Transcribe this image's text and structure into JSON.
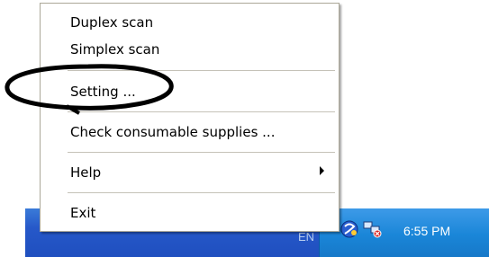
{
  "menu": {
    "items": [
      {
        "label": "Duplex scan"
      },
      {
        "label": "Simplex scan"
      },
      {
        "label": "Setting ..."
      },
      {
        "label": "Check consumable supplies ..."
      },
      {
        "label": "Help"
      },
      {
        "label": "Exit"
      }
    ]
  },
  "taskbar": {
    "language_indicator": "EN",
    "clock": "6:55 PM"
  },
  "icons": {
    "tray": [
      "scanner-icon",
      "network-icon"
    ],
    "submenu": "chevron-right-icon"
  },
  "colors": {
    "taskbar": "#2658c9",
    "tray": "#1a86d8",
    "annotation": "#000000"
  }
}
